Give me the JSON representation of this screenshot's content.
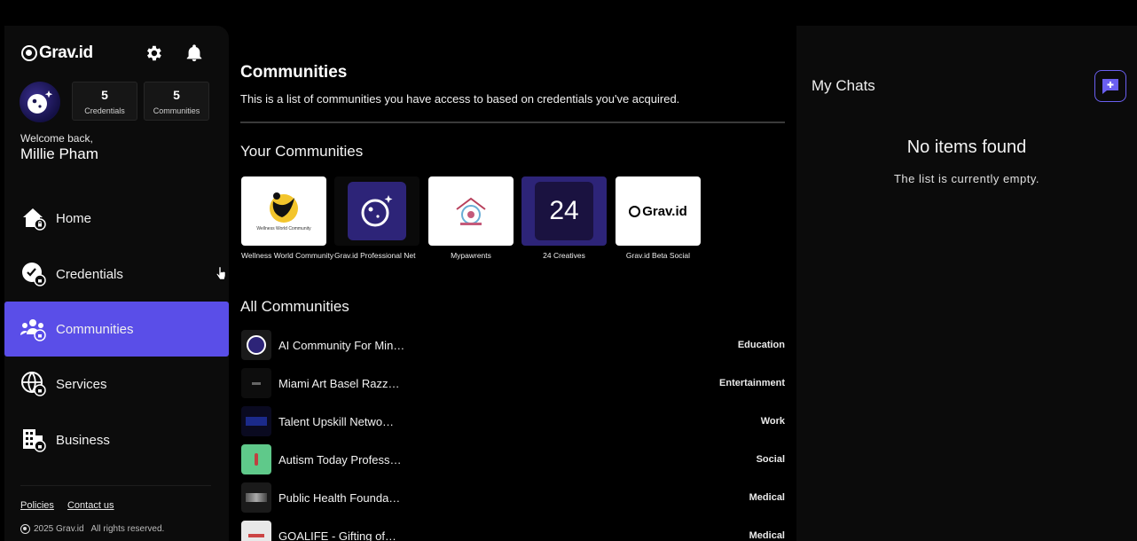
{
  "brand": {
    "name": "Grav.id"
  },
  "user": {
    "welcome": "Welcome back,",
    "name": "Millie Pham",
    "stats": [
      {
        "value": "5",
        "label": "Credentials"
      },
      {
        "value": "5",
        "label": "Communities"
      }
    ]
  },
  "nav": [
    {
      "label": "Home",
      "icon": "home-icon"
    },
    {
      "label": "Credentials",
      "icon": "credentials-icon"
    },
    {
      "label": "Communities",
      "icon": "communities-icon",
      "active": true
    },
    {
      "label": "Services",
      "icon": "services-icon"
    },
    {
      "label": "Business",
      "icon": "business-icon"
    }
  ],
  "footer": {
    "policies": "Policies",
    "contact": "Contact us",
    "copyright": "2025 Grav.id",
    "rights": "All rights reserved."
  },
  "main": {
    "title": "Communities",
    "description": "This is a list of communities you have access to based on credentials you've acquired.",
    "your_title": "Your Communities",
    "your_communities": [
      {
        "name": "Wellness World Community",
        "thumb_text": "Wellness World Community"
      },
      {
        "name": "Grav.id Professional Net"
      },
      {
        "name": "Mypawrents"
      },
      {
        "name": "24 Creatives",
        "thumb_text": "24"
      },
      {
        "name": "Grav.id Beta Social",
        "thumb_text": "Grav.id"
      }
    ],
    "all_title": "All Communities",
    "all_communities": [
      {
        "name": "AI Community For Min…",
        "category": "Education"
      },
      {
        "name": "Miami Art Basel Razz…",
        "category": "Entertainment"
      },
      {
        "name": "Talent Upskill Netwo…",
        "category": "Work"
      },
      {
        "name": "Autism Today Profess…",
        "category": "Social"
      },
      {
        "name": "Public Health Founda…",
        "category": "Medical"
      },
      {
        "name": "GOALIFE - Gifting of…",
        "category": "Medical"
      }
    ]
  },
  "chats": {
    "title": "My Chats",
    "empty_title": "No items found",
    "empty_sub": "The list is currently empty."
  },
  "colors": {
    "accent": "#5a4ee8",
    "background": "#000000",
    "panel": "#0c0c0c"
  }
}
